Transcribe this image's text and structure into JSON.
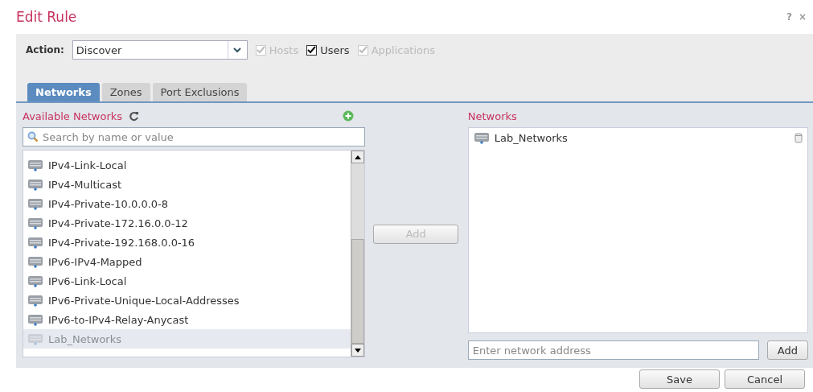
{
  "window": {
    "title": "Edit Rule",
    "help": "?",
    "close": "×"
  },
  "action": {
    "label": "Action:",
    "value": "Discover"
  },
  "options": [
    {
      "label": "Hosts",
      "checked": true,
      "disabled": true
    },
    {
      "label": "Users",
      "checked": true,
      "disabled": false
    },
    {
      "label": "Applications",
      "checked": true,
      "disabled": true
    }
  ],
  "tabs": [
    {
      "label": "Networks",
      "selected": true
    },
    {
      "label": "Zones",
      "selected": false
    },
    {
      "label": "Port Exclusions",
      "selected": false
    }
  ],
  "available": {
    "title": "Available Networks",
    "search_placeholder": "Search by name or value",
    "items": [
      {
        "label": "IPv4-Link-Local",
        "disabled": false
      },
      {
        "label": "IPv4-Multicast",
        "disabled": false
      },
      {
        "label": "IPv4-Private-10.0.0.0-8",
        "disabled": false
      },
      {
        "label": "IPv4-Private-172.16.0.0-12",
        "disabled": false
      },
      {
        "label": "IPv4-Private-192.168.0.0-16",
        "disabled": false
      },
      {
        "label": "IPv6-IPv4-Mapped",
        "disabled": false
      },
      {
        "label": "IPv6-Link-Local",
        "disabled": false
      },
      {
        "label": "IPv6-Private-Unique-Local-Addresses",
        "disabled": false
      },
      {
        "label": "IPv6-to-IPv4-Relay-Anycast",
        "disabled": false
      },
      {
        "label": "Lab_Networks",
        "disabled": true
      }
    ]
  },
  "add_button": {
    "label": "Add",
    "disabled": true
  },
  "selected": {
    "title": "Networks",
    "items": [
      {
        "label": "Lab_Networks"
      }
    ],
    "address_placeholder": "Enter network address",
    "add_label": "Add"
  },
  "buttons": [
    "Save",
    "Cancel"
  ]
}
